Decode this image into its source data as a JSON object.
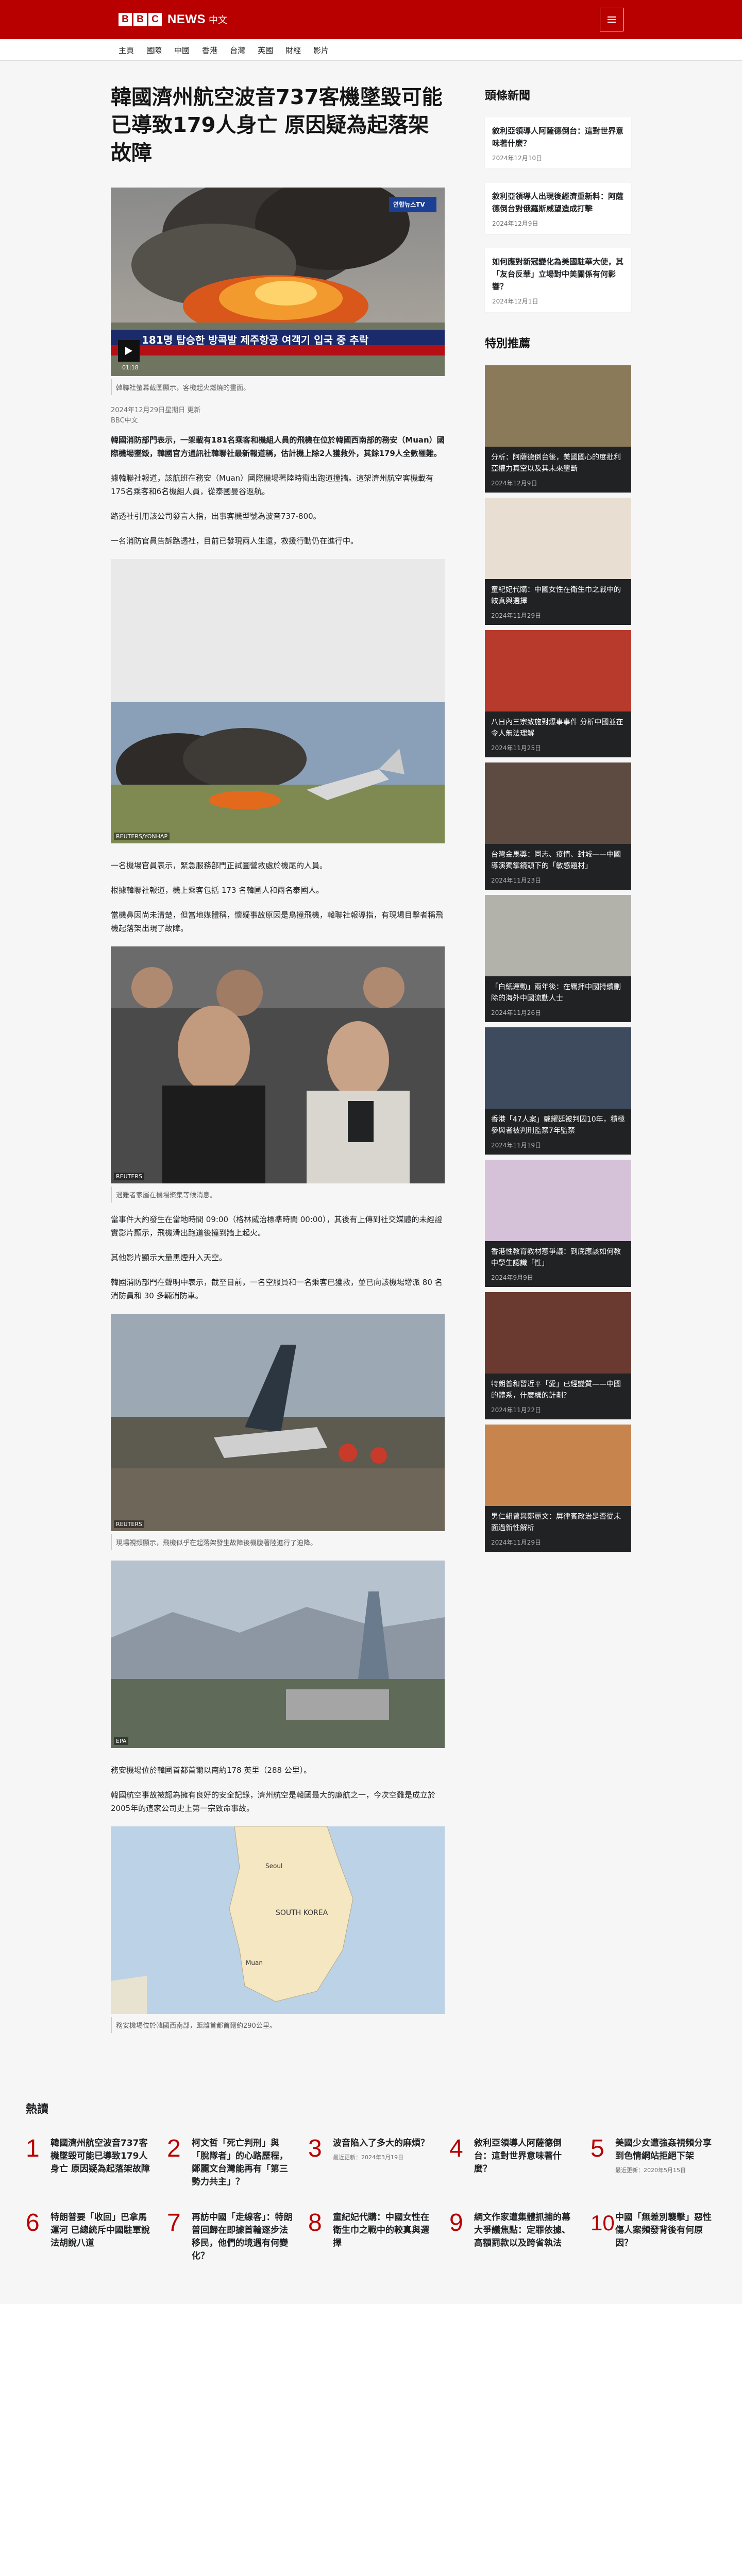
{
  "header": {
    "logo_letters": [
      "B",
      "B",
      "C"
    ],
    "logo_news": "NEWS",
    "logo_lang": "中文",
    "menu_icon": "menu-icon"
  },
  "nav": [
    "主頁",
    "國際",
    "中國",
    "香港",
    "台灣",
    "英國",
    "財經",
    "影片"
  ],
  "article": {
    "headline": "韓國濟州航空波音737客機墜毀可能已導致179人身亡 原因疑為起落架故障",
    "video": {
      "duration": "01:18",
      "logo_text": "연합뉴스TV",
      "ticker": "181명 탑승한 방콕발 제주항공 여객기 입국 중 추락",
      "caption": "韓聯社螢幕截圖顯示，客機起火燃燒的畫面。"
    },
    "meta": {
      "date": "2024年12月29日星期日 更新",
      "author": "BBC中文"
    },
    "paragraphs": [
      {
        "bold": "韓國消防部門表示，一架載有181名乘客和機組人員的飛機在位於韓國西南部的務安（Muan）國際機場墜毀，韓國官方通訊社韓聯社最新報道稱，估計機上除2人獲救外，其餘179人全數罹難。",
        "text": ""
      },
      {
        "bold": "",
        "text": "據韓聯社報道，該航班在務安（Muan）國際機場著陸時衝出跑道撞牆。這架濟州航空客機載有175名乘客和6名機組人員，從泰國曼谷返航。"
      },
      {
        "bold": "",
        "text": "路透社引用該公司發言人指，出事客機型號為波音737-800。"
      },
      {
        "bold": "",
        "text": "一名消防官員告訴路透社，目前已發現兩人生還，救援行動仍在進行中。"
      }
    ],
    "image1": {
      "credit": "REUTERS/YONHAP"
    },
    "paragraphs2": [
      "一名機場官員表示，緊急服務部門正試圖營救處於機尾的人員。",
      "根據韓聯社報道，機上乘客包括 173 名韓國人和兩名泰國人。",
      "當機鼻因尚未清楚，但當地媒體稱，懷疑事故原因是鳥撞飛機，韓聯社報導指，有現場目擊者稱飛機起落架出現了故障。"
    ],
    "image2": {
      "credit": "REUTERS",
      "caption": "遇難者家屬在機場聚集等候消息。"
    },
    "paragraphs3": [
      "當事件大約發生在當地時間 09:00（格林威治標準時間 00:00），其後有上傳到社交媒體的未經證實影片顯示，飛機滑出跑道後撞到牆上起火。",
      "其他影片顯示大量黑煙升入天空。",
      "韓國消防部門在聲明中表示，截至目前，一名空服員和一名乘客已獲救，並已向該機場增派 80 名消防員和 30 多輛消防車。"
    ],
    "image3": {
      "credit": "REUTERS",
      "caption": "現場視頻顯示，飛機似乎在起落架發生故障後機腹著陸進行了迫降。"
    },
    "image4": {
      "credit": "EPA"
    },
    "paragraphs4": [
      "務安機場位於韓國首都首爾以南約178 英里（288 公里）。",
      "韓國航空事故被認為擁有良好的安全記錄，濟州航空是韓國最大的廉航之一，今次空難是成立於2005年的這家公司史上第一宗致命事故。"
    ],
    "map": {
      "label_city": "Seoul",
      "label_country": "SOUTH KOREA",
      "label_muan": "Muan",
      "caption": "務安機場位於韓國西南部，距離首都首爾約290公里。"
    }
  },
  "sidebar": {
    "top_news_title": "頭條新聞",
    "top_news": [
      {
        "title": "敘利亞領導人阿薩德倒台：這對世界意味著什麼？",
        "date": "2024年12月10日"
      },
      {
        "title": "敘利亞領導人出現後經濟重新料：阿薩德倒台對俄羅斯威望造成打擊",
        "date": "2024年12月9日"
      },
      {
        "title": "如何應對新冠變化為美國駐華大使，其「友台反華」立場對中美關係有何影響？",
        "date": "2024年12月1日"
      }
    ],
    "featured_title": "特別推薦",
    "featured": [
      {
        "title": "分析：阿薩德倒台後，美國國心的度批利亞權力真空以及其未來壟斷",
        "date": "2024年12月9日"
      },
      {
        "title": "童紀妃代購：中國女性在衛生巾之戰中的較真與選擇",
        "date": "2024年11月29日"
      },
      {
        "title": "八日內三宗致施對爆事事件 分析中國並在令人無法理解",
        "date": "2024年11月25日"
      },
      {
        "title": "台灣金馬獎：同志、疫情、封城——中國導演獨掌鏡頭下的「敏感題材」",
        "date": "2024年11月23日"
      },
      {
        "title": "「白紙運動」兩年後：在羈押中國持續刪除的海外中國流動人士",
        "date": "2024年11月26日"
      },
      {
        "title": "香港「47人案」戴耀廷被判囚10年，積極參與者被判刑監禁7年監禁",
        "date": "2024年11月19日"
      },
      {
        "title": "香港性教育教材惹爭議：到底應該如何教中學生認識「性」",
        "date": "2024年9月9日"
      },
      {
        "title": "特朗普和習近平「愛」已經變質——中國的體系，什麼樣的計劃？",
        "date": "2024年11月22日"
      },
      {
        "title": "男仁組曾與鄭麗文：屏律賓政治是否從未面過新性解析",
        "date": "2024年11月29日"
      }
    ]
  },
  "popular": {
    "title": "熱讀",
    "items": [
      {
        "num": "1",
        "title": "韓國濟州航空波音737客機墜毀可能已導致179人身亡 原因疑為起落架故障",
        "date": ""
      },
      {
        "num": "2",
        "title": "柯文哲「死亡判刑」與「脫隊者」的心路歷程，鄭麗文台灣能再有「第三勢力共主」？",
        "date": ""
      },
      {
        "num": "3",
        "title": "波音陷入了多大的麻煩？",
        "date": "最近更新：2024年3月19日"
      },
      {
        "num": "4",
        "title": "敘利亞領導人阿薩德倒台：這對世界意味著什麼？",
        "date": ""
      },
      {
        "num": "5",
        "title": "美國少女遭強姦視頻分享到色情網站拒絕下架",
        "date": "最近更新：2020年5月15日"
      },
      {
        "num": "6",
        "title": "特朗普要「收回」巴拿馬運河 已總統斥中國駐軍說法胡說八道",
        "date": ""
      },
      {
        "num": "7",
        "title": "再訪中國「走線客」：特朗普回歸在即據首輪逐步法移民，他們的境遇有何變化？",
        "date": ""
      },
      {
        "num": "8",
        "title": "童紀妃代購：中國女性在衛生巾之戰中的較真與選擇",
        "date": ""
      },
      {
        "num": "9",
        "title": "網文作家遭集體抓捕的幕大爭議焦點：定罪依據、高額罰款以及跨省執法",
        "date": ""
      },
      {
        "num": "10",
        "title": "中國「無差別襲擊」惡性傷人案頻發背後有何原因？",
        "date": ""
      }
    ]
  },
  "colors": {
    "brand": "#b80000",
    "page_bg": "#f6f6f6",
    "text": "#202224"
  }
}
